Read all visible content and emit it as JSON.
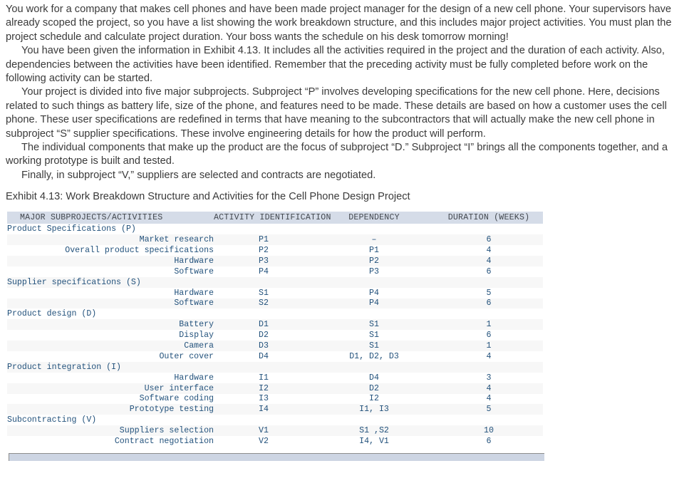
{
  "prose": {
    "paragraphs": [
      {
        "indent": false,
        "text": "You work for a company that makes cell phones and have been made project manager for the design of a new cell phone. Your supervisors have already scoped the project, so you have a list showing the work breakdown structure, and this includes major project activities. You must plan the project schedule and calculate project duration. Your boss wants the schedule on his desk tomorrow morning!"
      },
      {
        "indent": true,
        "text": "You have been given the information in Exhibit 4.13. It includes all the activities required in the project and the duration of each activity. Also, dependencies between the activities have been identified. Remember that the preceding activity must be fully completed before work on the following activity can be started."
      },
      {
        "indent": true,
        "text": "Your project is divided into five major subprojects. Subproject “P” involves developing specifications for the new cell phone. Here, decisions related to such things as battery life, size of the phone, and features need to be made. These details are based on how a customer uses the cell phone. These user specifications are redefined in terms that have meaning to the subcontractors that will actually make the new cell phone in subproject “S” supplier specifications. These involve engineering details for how the product will perform."
      },
      {
        "indent": true,
        "text": "The individual components that make up the product are the focus of subproject “D.” Subproject “I” brings all the components together, and a working prototype is built and tested."
      },
      {
        "indent": true,
        "text": "Finally, in subproject “V,” suppliers are selected and contracts are negotiated."
      }
    ]
  },
  "exhibit": {
    "caption": "Exhibit 4.13: Work Breakdown Structure and Activities for the Cell Phone Design Project",
    "colors": {
      "header_band": "#d5dce8",
      "stripe": "#f7f7f7",
      "table_text": "#23527c",
      "header_text": "#43484f",
      "bottom_bar": "#cdd5e3"
    },
    "columns": [
      "MAJOR SUBPROJECTS/ACTIVITIES",
      "ACTIVITY IDENTIFICATION",
      "DEPENDENCY",
      "DURATION (WEEKS)"
    ],
    "rows": [
      {
        "kind": "group",
        "name": "Product Specifications (P)",
        "id": "",
        "dependency": "",
        "duration": ""
      },
      {
        "kind": "activity",
        "name": "Market research",
        "id": "P1",
        "dependency": "–",
        "duration": "6"
      },
      {
        "kind": "activity",
        "name": "Overall product specifications",
        "id": "P2",
        "dependency": "P1",
        "duration": "4"
      },
      {
        "kind": "activity",
        "name": "Hardware",
        "id": "P3",
        "dependency": "P2",
        "duration": "4"
      },
      {
        "kind": "activity",
        "name": "Software",
        "id": "P4",
        "dependency": "P3",
        "duration": "6"
      },
      {
        "kind": "group",
        "name": "Supplier specifications (S)",
        "id": "",
        "dependency": "",
        "duration": ""
      },
      {
        "kind": "activity",
        "name": "Hardware",
        "id": "S1",
        "dependency": "P4",
        "duration": "5"
      },
      {
        "kind": "activity",
        "name": "Software",
        "id": "S2",
        "dependency": "P4",
        "duration": "6"
      },
      {
        "kind": "group",
        "name": "Product design (D)",
        "id": "",
        "dependency": "",
        "duration": ""
      },
      {
        "kind": "activity",
        "name": "Battery",
        "id": "D1",
        "dependency": "S1",
        "duration": "1"
      },
      {
        "kind": "activity",
        "name": "Display",
        "id": "D2",
        "dependency": "S1",
        "duration": "6"
      },
      {
        "kind": "activity",
        "name": "Camera",
        "id": "D3",
        "dependency": "S1",
        "duration": "1"
      },
      {
        "kind": "activity",
        "name": "Outer cover",
        "id": "D4",
        "dependency": "D1, D2, D3",
        "duration": "4"
      },
      {
        "kind": "group",
        "name": "Product integration (I)",
        "id": "",
        "dependency": "",
        "duration": ""
      },
      {
        "kind": "activity",
        "name": "Hardware",
        "id": "I1",
        "dependency": "D4",
        "duration": "3"
      },
      {
        "kind": "activity",
        "name": "User interface",
        "id": "I2",
        "dependency": "D2",
        "duration": "4"
      },
      {
        "kind": "activity",
        "name": "Software coding",
        "id": "I3",
        "dependency": "I2",
        "duration": "4"
      },
      {
        "kind": "activity",
        "name": "Prototype testing",
        "id": "I4",
        "dependency": "I1, I3",
        "duration": "5"
      },
      {
        "kind": "group",
        "name": "Subcontracting (V)",
        "id": "",
        "dependency": "",
        "duration": ""
      },
      {
        "kind": "activity",
        "name": "Suppliers selection",
        "id": "V1",
        "dependency": "S1 ,S2",
        "duration": "10"
      },
      {
        "kind": "activity",
        "name": "Contract negotiation",
        "id": "V2",
        "dependency": "I4, V1",
        "duration": "6"
      }
    ]
  }
}
